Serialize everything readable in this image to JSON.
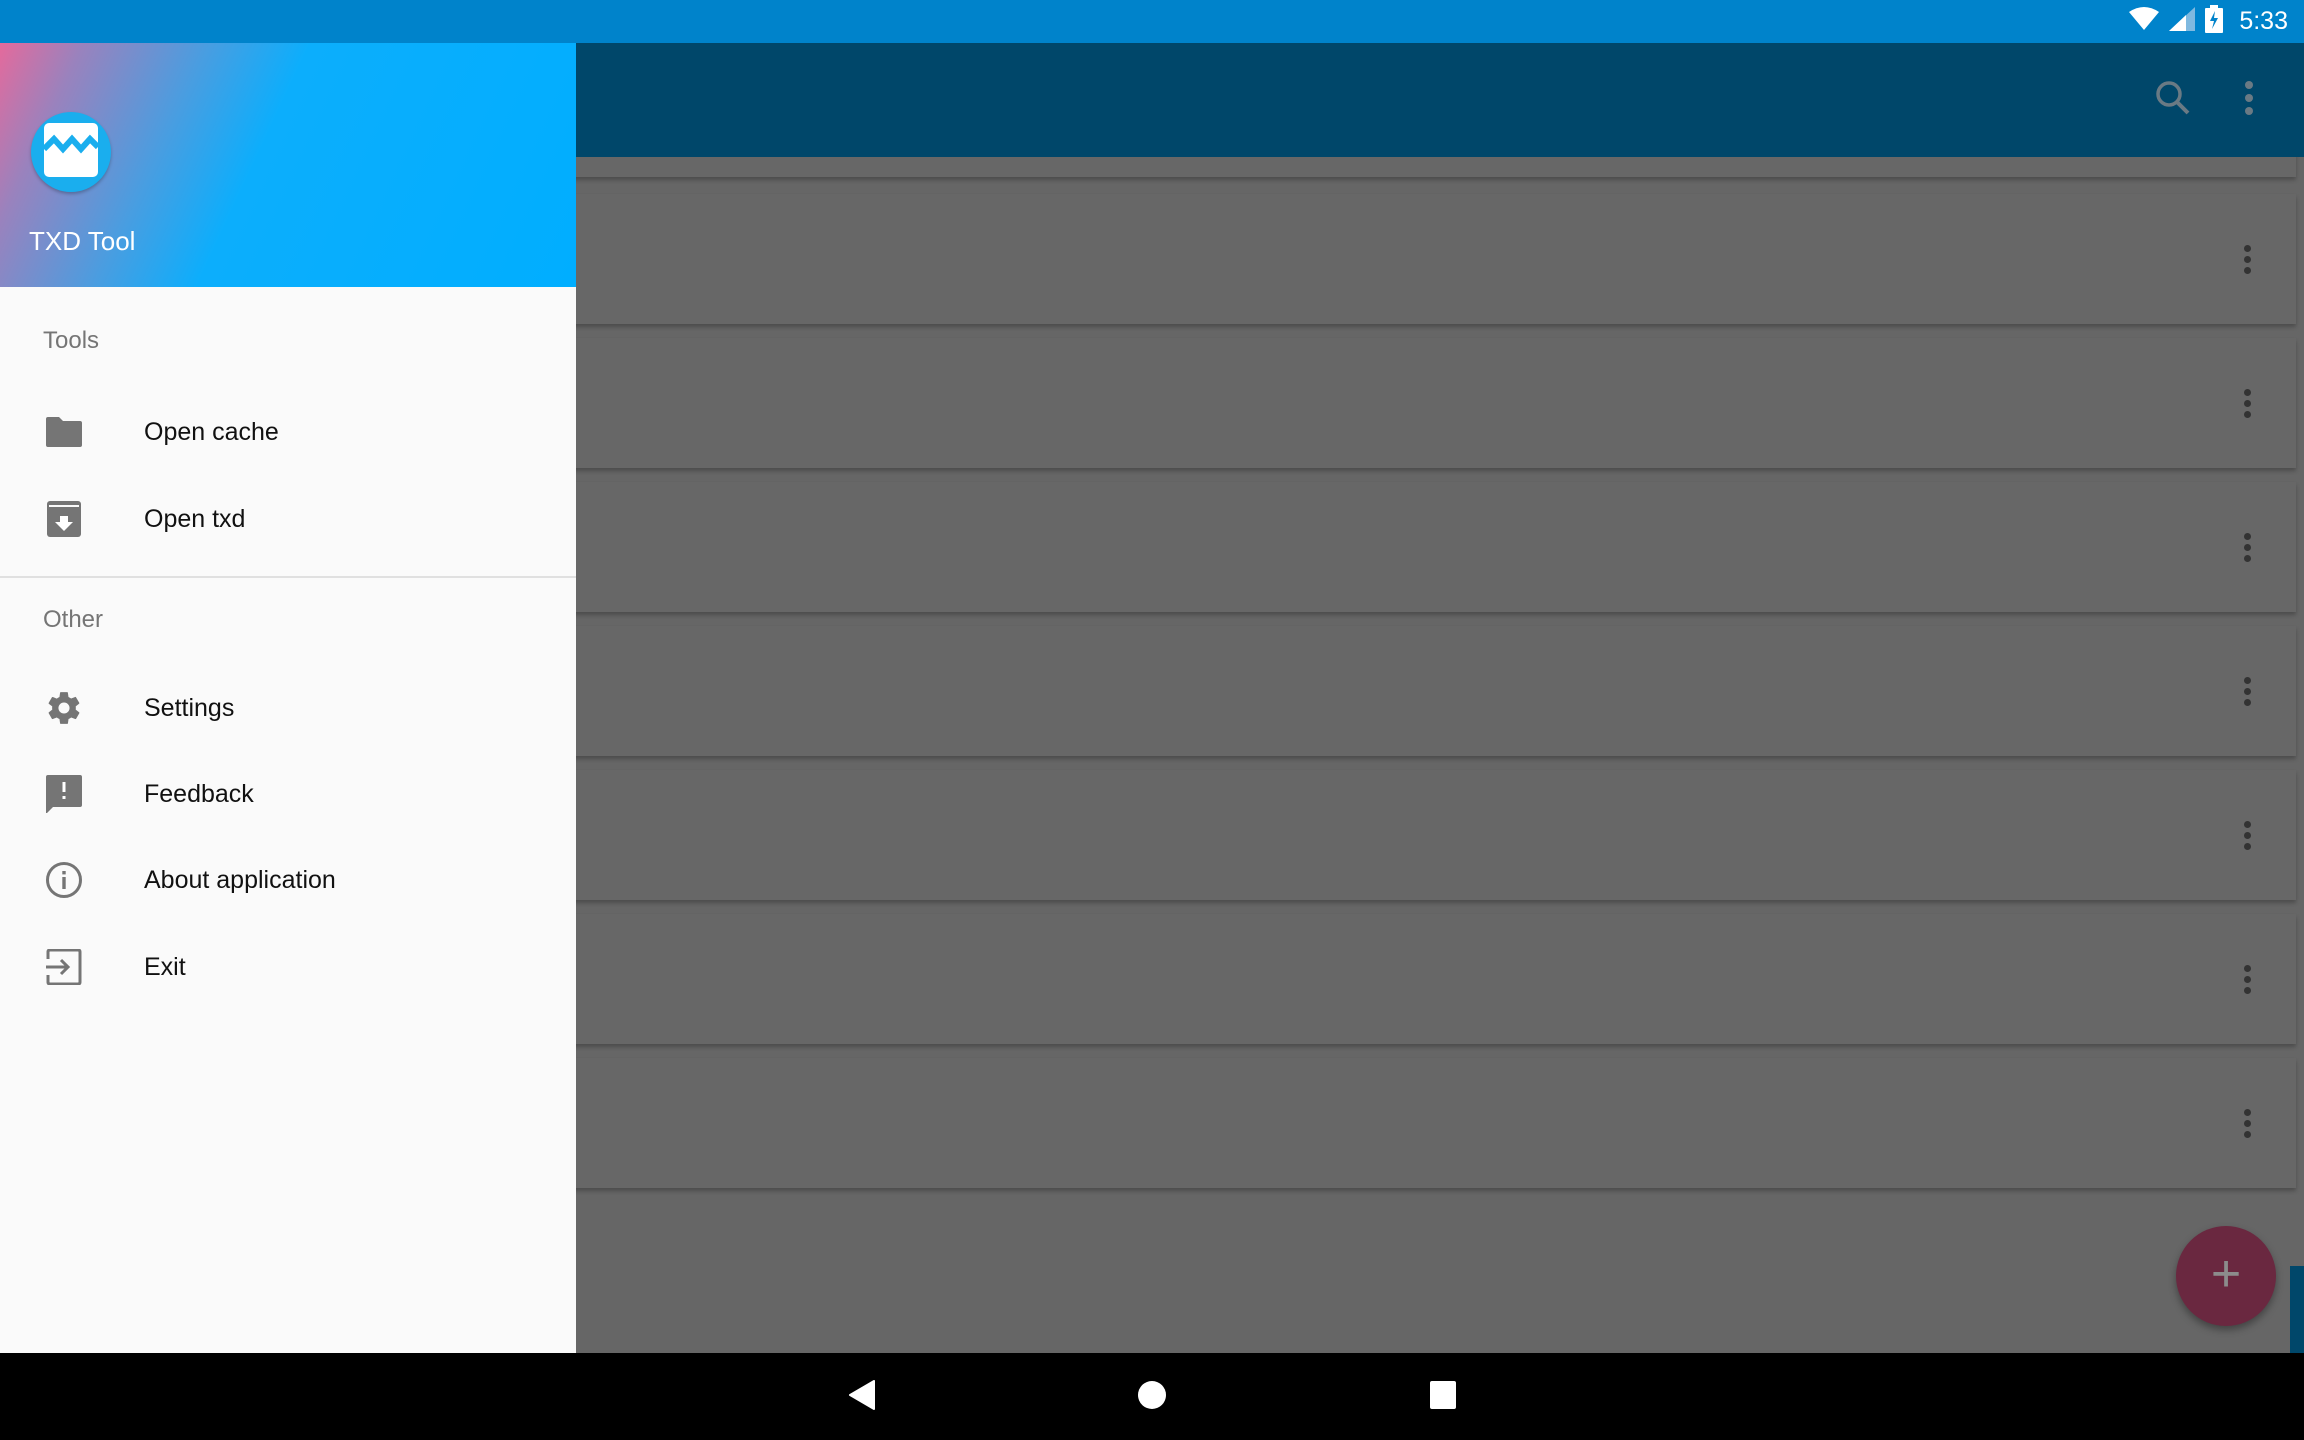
{
  "status_bar": {
    "time": "5:33",
    "icons": [
      "wifi-icon",
      "cell-signal-icon",
      "battery-charging-icon"
    ],
    "color": "#0083cb"
  },
  "toolbar": {
    "color": "#00476a",
    "actions": [
      {
        "name": "search-icon",
        "label": "Search"
      },
      {
        "name": "more-vert-icon",
        "label": "More options"
      }
    ]
  },
  "drawer": {
    "header": {
      "app_name": "TXD Tool",
      "logo_icon": "txd-tool-logo-icon"
    },
    "sections": [
      {
        "label": "Tools",
        "items": [
          {
            "label": "Open cache",
            "icon": "folder-icon"
          },
          {
            "label": "Open txd",
            "icon": "archive-download-icon"
          }
        ]
      },
      {
        "label": "Other",
        "items": [
          {
            "label": "Settings",
            "icon": "gear-icon"
          },
          {
            "label": "Feedback",
            "icon": "feedback-icon"
          },
          {
            "label": "About application",
            "icon": "info-icon"
          },
          {
            "label": "Exit",
            "icon": "exit-icon"
          }
        ]
      }
    ]
  },
  "content": {
    "card_count": 8,
    "card_menu_icon": "more-vert-icon"
  },
  "fab": {
    "icon": "plus-icon",
    "label": "+",
    "color": "#6a2840"
  },
  "nav_bar": {
    "buttons": [
      "back-icon",
      "home-icon",
      "recents-icon"
    ]
  }
}
